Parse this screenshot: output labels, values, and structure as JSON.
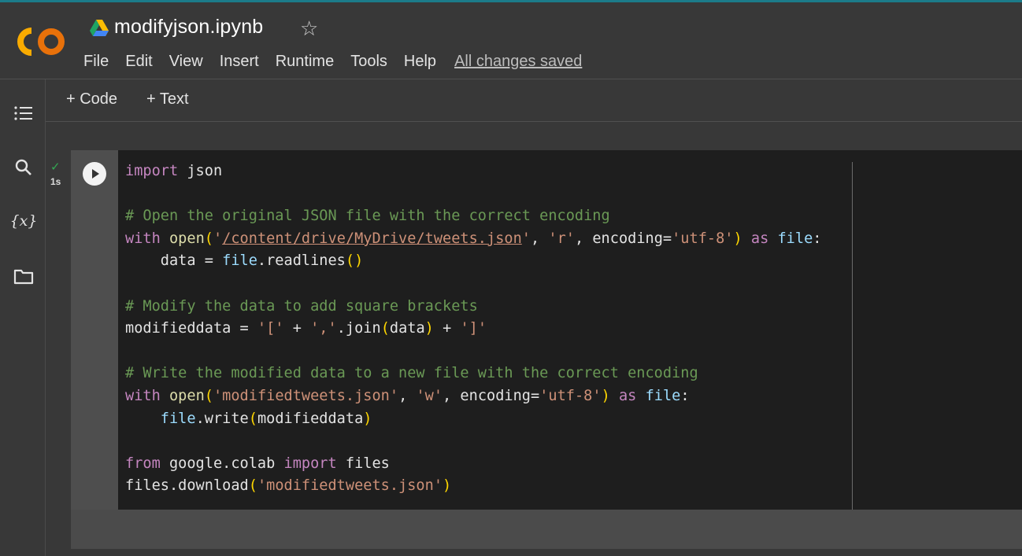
{
  "app": {
    "notebook_title": "modifyjson.ipynb",
    "star_glyph": "☆"
  },
  "menu": {
    "items": [
      {
        "label": "File"
      },
      {
        "label": "Edit"
      },
      {
        "label": "View"
      },
      {
        "label": "Insert"
      },
      {
        "label": "Runtime"
      },
      {
        "label": "Tools"
      },
      {
        "label": "Help"
      }
    ],
    "save_status": "All changes saved"
  },
  "toolbar": {
    "add_code": "+ Code",
    "add_text": "+ Text"
  },
  "sidebar": {
    "icons": [
      {
        "name": "table-of-contents-icon"
      },
      {
        "name": "search-icon"
      },
      {
        "name": "variables-icon"
      },
      {
        "name": "files-folder-icon"
      }
    ]
  },
  "cell": {
    "execution_status": "✓",
    "execution_time": "1s",
    "code_lines": [
      "import json",
      "",
      "# Open the original JSON file with the correct encoding",
      "with open('/content/drive/MyDrive/tweets.json', 'r', encoding='utf-8') as file:",
      "    data = file.readlines()",
      "",
      "# Modify the data to add square brackets",
      "modifieddata = '[' + ','.join(data) + ']'",
      "",
      "# Write the modified data to a new file with the correct encoding",
      "with open('modifiedtweets.json', 'w', encoding='utf-8') as file:",
      "    file.write(modifieddata)",
      "",
      "from google.colab import files",
      "files.download('modifiedtweets.json')"
    ]
  },
  "colors": {
    "accent_top": "#1c7b8a",
    "keyword": "#c586c0",
    "string": "#ce9178",
    "comment": "#6a9955",
    "variable": "#9cdcfe",
    "function": "#dcdcaa",
    "success": "#34a853"
  }
}
